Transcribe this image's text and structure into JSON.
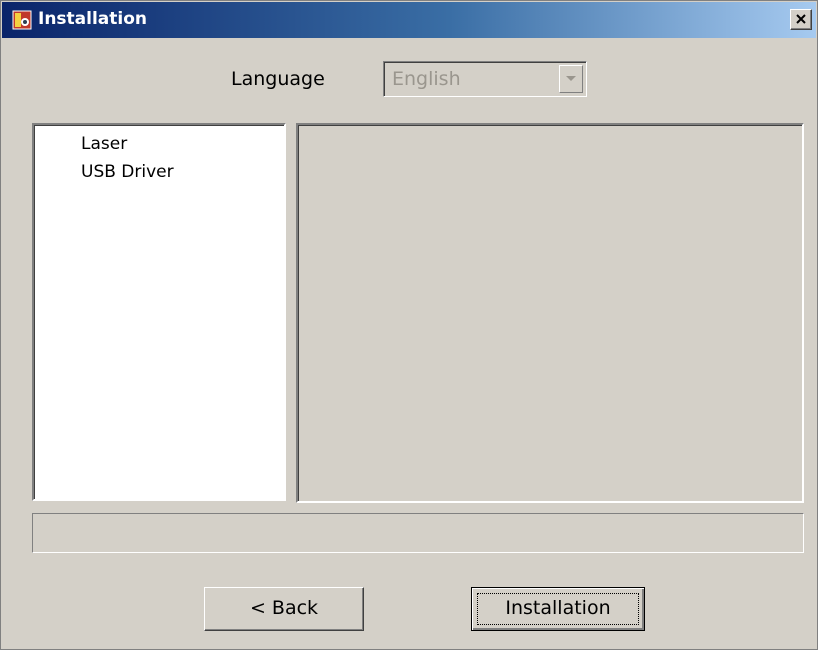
{
  "window": {
    "title": "Installation",
    "app_icon": "installer-app-icon",
    "close_icon": "close-icon",
    "colors": {
      "title_gradient_start": "#0a246a",
      "title_gradient_end": "#a6caf0",
      "face": "#d4d0c8"
    }
  },
  "language": {
    "label": "Language",
    "selected": "English",
    "arrow_icon": "chevron-down-icon"
  },
  "tree": {
    "items": [
      {
        "label": "Laser"
      },
      {
        "label": "USB Driver"
      }
    ]
  },
  "buttons": {
    "back_label": "< Back",
    "install_label": "Installation"
  }
}
